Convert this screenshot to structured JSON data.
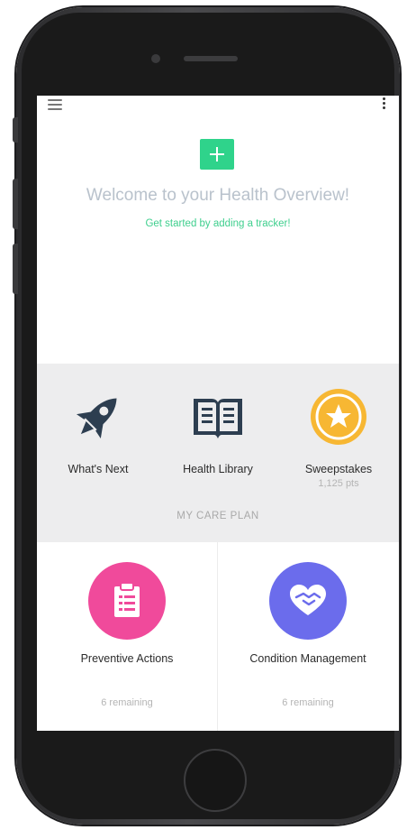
{
  "header": {
    "menu_icon": "hamburger-menu-icon",
    "more_icon": "vertical-dots-icon"
  },
  "welcome": {
    "add_icon": "plus-icon",
    "title": "Welcome to your Health Overview!",
    "subtitle": "Get started by adding a tracker!",
    "accent_color": "#2fd38b"
  },
  "quick_links": [
    {
      "label": "What's Next",
      "icon": "rocket-icon",
      "color": "#2d3e50"
    },
    {
      "label": "Health Library",
      "icon": "open-book-icon",
      "color": "#2d3e50"
    },
    {
      "label": "Sweepstakes",
      "sub": "1,125 pts",
      "icon": "star-badge-icon",
      "color": "#f7b733"
    }
  ],
  "care_plan": {
    "section_label": "MY CARE PLAN",
    "cards": [
      {
        "title": "Preventive Actions",
        "remaining": "6 remaining",
        "icon": "clipboard-icon",
        "color": "#f04a9b"
      },
      {
        "title": "Condition Management",
        "remaining": "6 remaining",
        "icon": "heart-handshake-icon",
        "color": "#6b6cec"
      }
    ]
  }
}
